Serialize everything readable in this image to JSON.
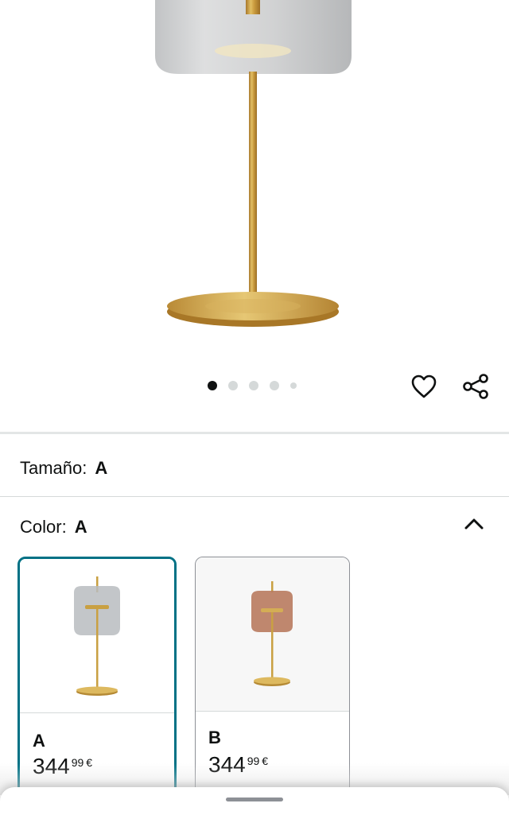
{
  "carousel": {
    "dots_count": 5,
    "active_index": 0
  },
  "actions": {
    "wishlist_icon": "heart-outline-icon",
    "share_icon": "share-icon"
  },
  "size": {
    "label": "Tamaño:",
    "value": "A"
  },
  "color": {
    "label": "Color:",
    "value": "A",
    "expanded_icon": "chevron-up-icon",
    "options": [
      {
        "name": "A",
        "price_whole": "344",
        "price_fraction": "99",
        "currency": "€",
        "selected": true,
        "glass_color": "#b9bcbf"
      },
      {
        "name": "B",
        "price_whole": "344",
        "price_fraction": "99",
        "currency": "€",
        "selected": false,
        "glass_color": "#b87a5e"
      }
    ]
  },
  "colors": {
    "selected_border": "#007185",
    "gold": "#c9a042",
    "text": "#0f1111"
  }
}
